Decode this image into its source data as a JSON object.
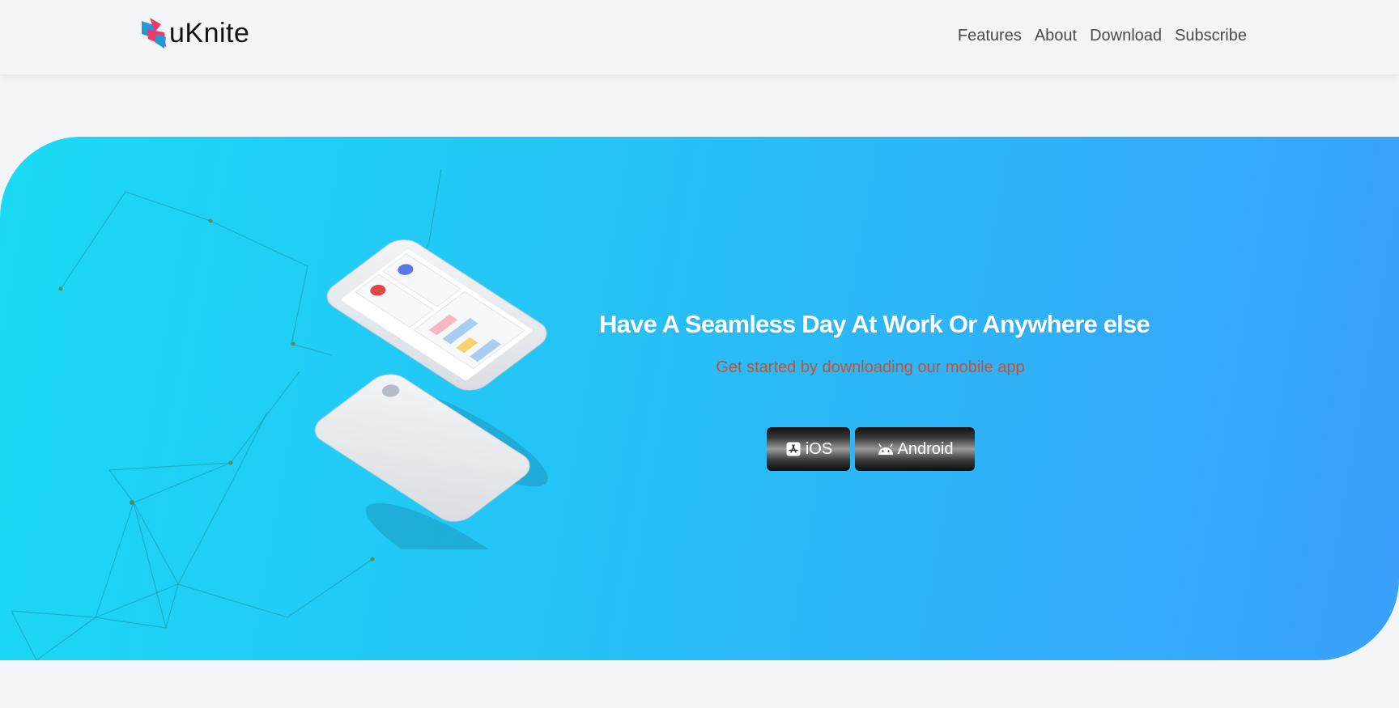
{
  "brand": {
    "name": "uKnite"
  },
  "nav": {
    "items": [
      {
        "label": "Features"
      },
      {
        "label": "About"
      },
      {
        "label": "Download"
      },
      {
        "label": "Subscribe"
      }
    ]
  },
  "hero": {
    "title": "Have A Seamless Day At Work Or Anywhere else",
    "subtitle": "Get started by downloading our mobile app",
    "buttons": {
      "ios_label": "iOS",
      "ios_icon": "app-store-icon",
      "android_label": "Android",
      "android_icon": "android-icon"
    }
  },
  "colors": {
    "page_bg": "#f4f5f9",
    "hero_gradient_start": "#1bdaf5",
    "hero_gradient_end": "#3aa0fb",
    "subtitle": "#c9502a",
    "logo_pink": "#f0386b",
    "logo_blue": "#1e9bd7"
  }
}
